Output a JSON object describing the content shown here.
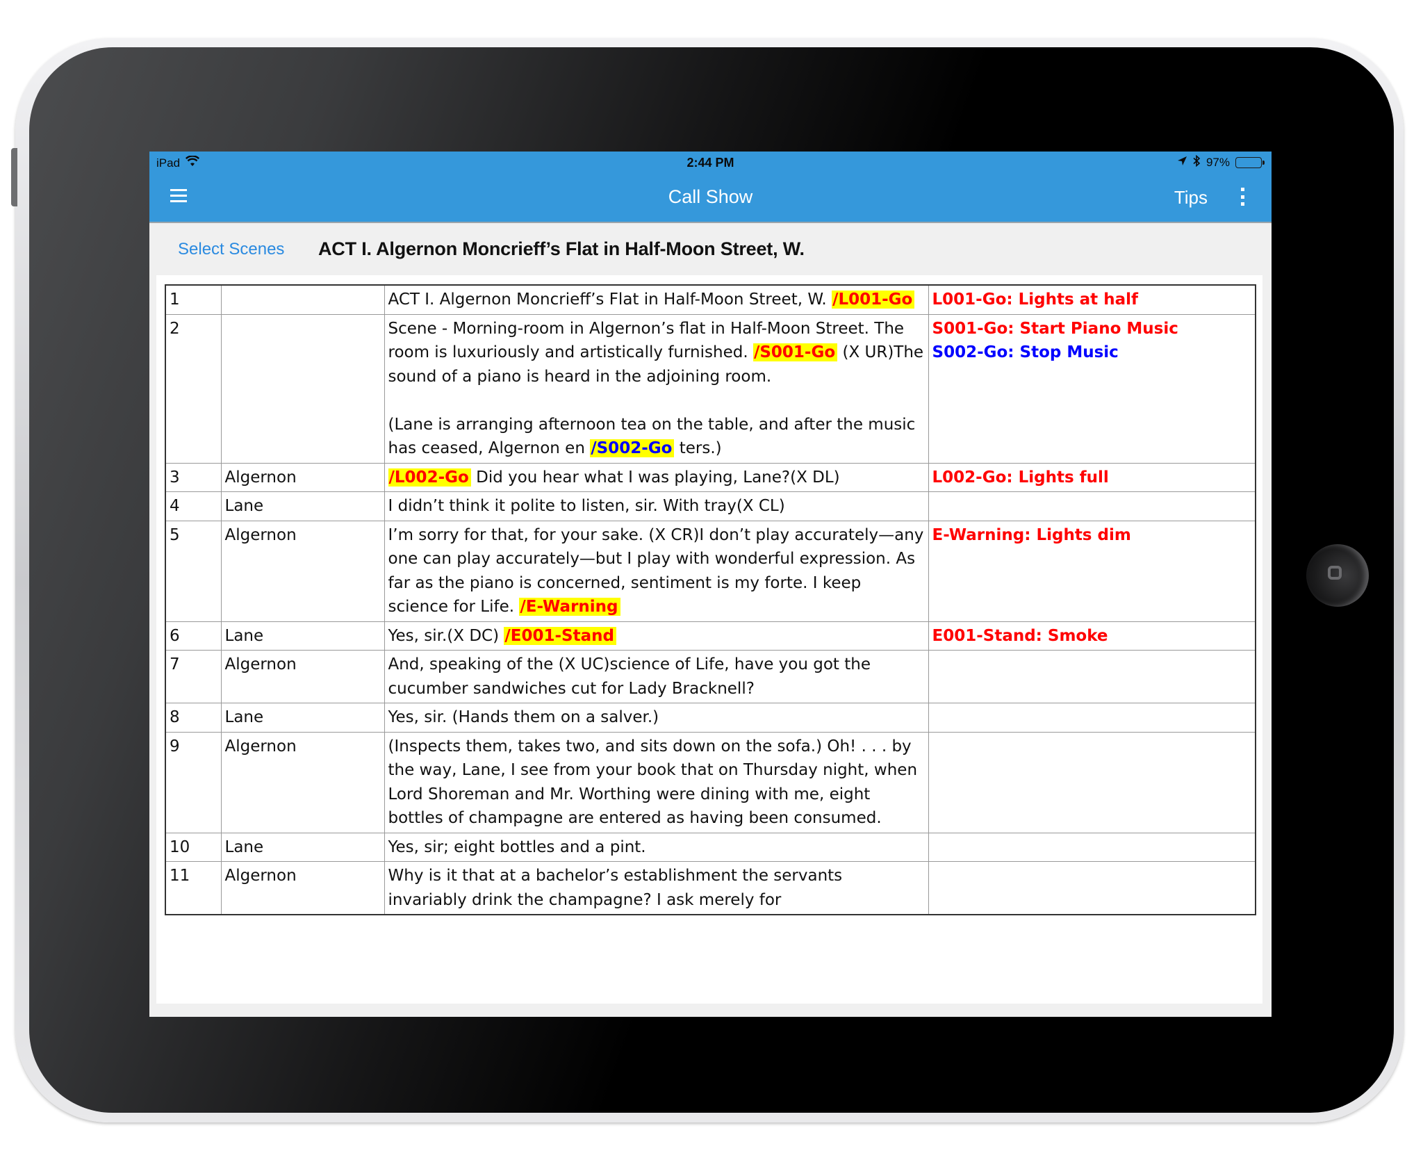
{
  "status_bar": {
    "device": "iPad",
    "time": "2:44 PM",
    "battery_text": "97%",
    "battery_level": 0.97
  },
  "nav": {
    "title": "Call Show",
    "tips_label": "Tips"
  },
  "subheader": {
    "select_scenes_label": "Select Scenes",
    "scene_title": "ACT I. Algernon Moncrieff’s Flat in Half-Moon Street, W."
  },
  "colors": {
    "nav_bg": "#3598db",
    "link": "#2a8ae0",
    "cue_red": "#ff0000",
    "cue_blue": "#0000ff",
    "cue_highlight": "#ffff00"
  },
  "rows": [
    {
      "num": "1",
      "character": "",
      "line": [
        {
          "t": "ACT I. Algernon Moncrieff’s Flat in Half-Moon Street, W. "
        },
        {
          "cue": "/L001-Go",
          "color": "red"
        }
      ],
      "notes": [
        {
          "text": "L001-Go: Lights at half",
          "color": "red"
        }
      ]
    },
    {
      "num": "2",
      "character": "",
      "line": [
        {
          "t": "Scene - Morning-room in Algernon’s flat in Half-Moon Street.  The room is luxuriously and artistically furnished. "
        },
        {
          "cue": "/S001-Go",
          "color": "red"
        },
        {
          "t": " (X UR)The sound of a piano is heard in the adjoining room."
        },
        {
          "br": true
        },
        {
          "t": "(Lane is arranging afternoon tea on the table, and after the music has ceased, Algernon en "
        },
        {
          "cue": "/S002-Go",
          "color": "blue"
        },
        {
          "t": " ters.)"
        }
      ],
      "notes": [
        {
          "text": "S001-Go: Start Piano Music",
          "color": "red"
        },
        {
          "text": "S002-Go: Stop Music",
          "color": "blue"
        }
      ]
    },
    {
      "num": "3",
      "character": "Algernon",
      "line": [
        {
          "cue": "/L002-Go",
          "color": "red"
        },
        {
          "t": " Did you hear what I was playing, Lane?(X DL)"
        }
      ],
      "notes": [
        {
          "text": "L002-Go: Lights full",
          "color": "red"
        }
      ]
    },
    {
      "num": "4",
      "character": "Lane",
      "line": [
        {
          "t": "I didn’t think it polite to listen, sir. With tray(X CL)"
        }
      ],
      "notes": []
    },
    {
      "num": "5",
      "character": "Algernon",
      "line": [
        {
          "t": "I’m sorry for that, for your sake.  (X CR)I don’t play accurately—any one can play accurately—but I play with wonderful expression.  As far as the piano is concerned, sentiment is my forte.  I keep science for Life. "
        },
        {
          "cue": "/E-Warning",
          "color": "red"
        }
      ],
      "notes": [
        {
          "text": "E-Warning: Lights dim",
          "color": "red"
        }
      ]
    },
    {
      "num": "6",
      "character": "Lane",
      "line": [
        {
          "t": "Yes, sir.(X DC) "
        },
        {
          "cue": "/E001-Stand",
          "color": "red"
        }
      ],
      "notes": [
        {
          "text": "E001-Stand: Smoke",
          "color": "red"
        }
      ]
    },
    {
      "num": "7",
      "character": "Algernon",
      "line": [
        {
          "t": "And, speaking of the (X UC)science of Life, have you got the cucumber sandwiches cut for Lady Bracknell?"
        }
      ],
      "notes": []
    },
    {
      "num": "8",
      "character": "Lane",
      "line": [
        {
          "t": "Yes, sir.  (Hands them on a salver.)"
        }
      ],
      "notes": []
    },
    {
      "num": "9",
      "character": "Algernon",
      "line": [
        {
          "t": "(Inspects them, takes two, and sits down on the sofa.)  Oh! . . . by the way, Lane, I see from your book that on Thursday night, when Lord Shoreman and Mr. Worthing were dining with me, eight bottles of champagne are entered as having been consumed."
        }
      ],
      "notes": []
    },
    {
      "num": "10",
      "character": "Lane",
      "line": [
        {
          "t": "Yes, sir; eight bottles and a pint."
        }
      ],
      "notes": []
    },
    {
      "num": "11",
      "character": "Algernon",
      "line": [
        {
          "t": "Why is it that at a bachelor’s establishment the servants invariably drink the champagne?  I ask merely for"
        }
      ],
      "notes": []
    }
  ]
}
